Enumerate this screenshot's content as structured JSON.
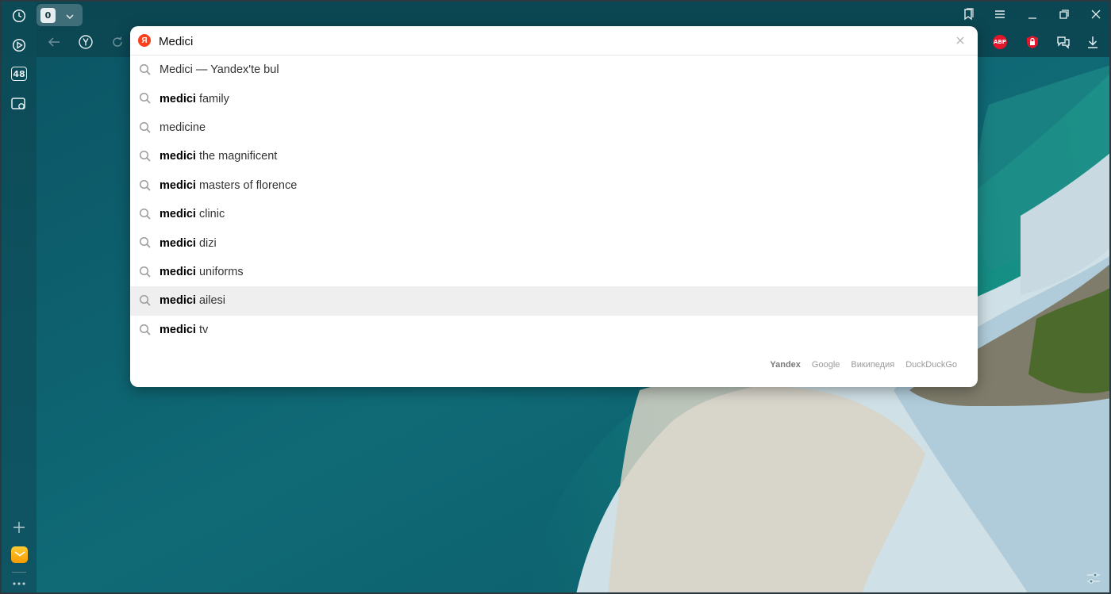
{
  "sidebar": {
    "tabs_count_badge": "48"
  },
  "tabbar": {
    "tab_count": "0"
  },
  "omnibox": {
    "value": "Medici",
    "suggestions": [
      {
        "bold": "",
        "rest": "Medici — Yandex'te bul"
      },
      {
        "bold": "medici",
        "rest": " family"
      },
      {
        "bold": "",
        "rest": "medicine"
      },
      {
        "bold": "medici",
        "rest": " the magnificent"
      },
      {
        "bold": "medici",
        "rest": " masters of florence"
      },
      {
        "bold": "medici",
        "rest": " clinic"
      },
      {
        "bold": "medici",
        "rest": " dizi"
      },
      {
        "bold": "medici",
        "rest": " uniforms"
      },
      {
        "bold": "medici",
        "rest": " ailesi"
      },
      {
        "bold": "medici",
        "rest": " tv"
      }
    ],
    "highlighted_index": 8,
    "engines": [
      "Yandex",
      "Google",
      "Википедия",
      "DuckDuckGo"
    ],
    "active_engine": "Yandex"
  },
  "extensions": {
    "abp_label": "ABP"
  },
  "icons": {
    "history": "clock-icon",
    "media": "play-icon",
    "screenshot": "camera-icon",
    "add": "plus-icon",
    "mail": "mail-icon",
    "more": "more-icon",
    "back": "back-arrow-icon",
    "yandex": "yandex-logo-icon",
    "reload": "reload-icon",
    "bookmarks": "bookmarks-icon",
    "menu": "hamburger-icon",
    "minimize": "minimize-icon",
    "restore": "restore-icon",
    "close": "close-icon",
    "download": "download-icon",
    "settings": "sliders-icon"
  },
  "colors": {
    "yandex_red": "#fc3f1d",
    "abp_red": "#e3162c",
    "highlight_row": "#efefef"
  }
}
